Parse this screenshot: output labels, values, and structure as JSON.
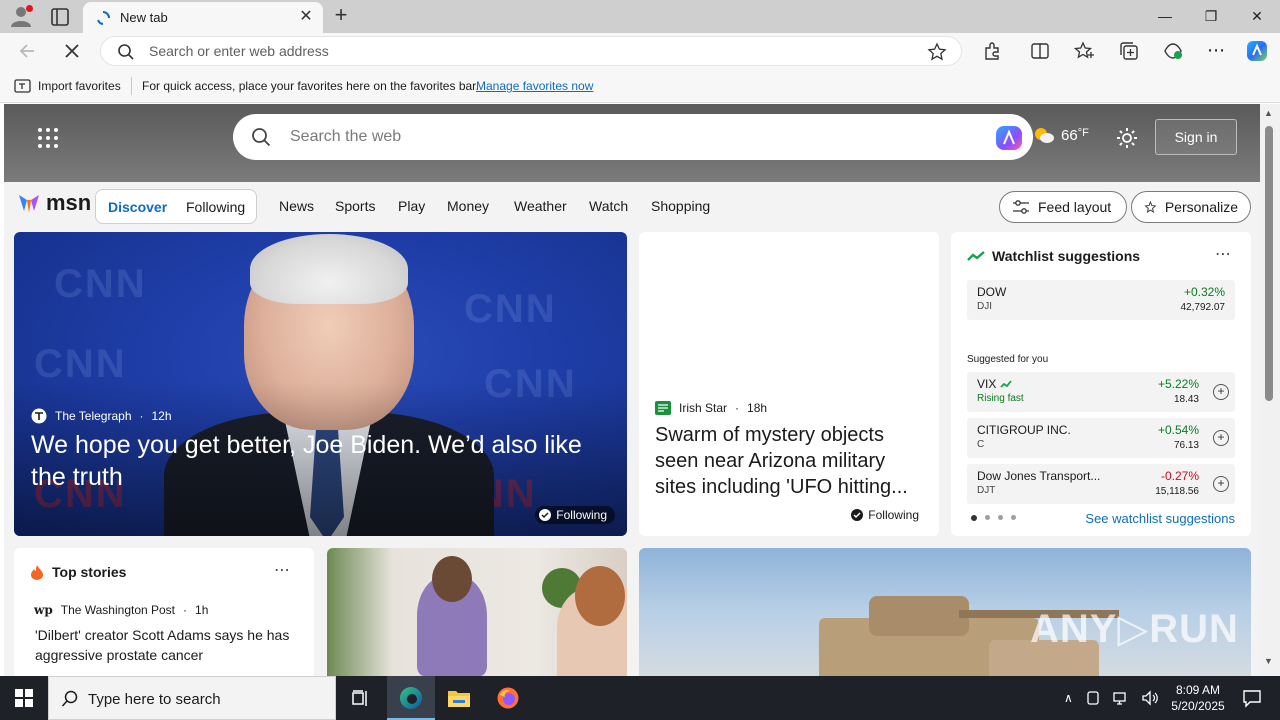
{
  "browser": {
    "tab_title": "New tab",
    "address_placeholder": "Search or enter web address"
  },
  "favorites_bar": {
    "import_label": "Import favorites",
    "hint": "For quick access, place your favorites here on the favorites bar.",
    "manage_link": "Manage favorites now"
  },
  "msn_header": {
    "search_placeholder": "Search the web",
    "temperature": "66",
    "temp_unit": "°F",
    "sign_in": "Sign in",
    "logo": "msn"
  },
  "feed_nav": {
    "segments": [
      "Discover",
      "Following"
    ],
    "links": [
      "News",
      "Sports",
      "Play",
      "Money",
      "Weather",
      "Watch",
      "Shopping"
    ],
    "feed_layout": "Feed layout",
    "personalize": "Personalize"
  },
  "hero": {
    "source": "The Telegraph",
    "age": "12h",
    "title": "We hope you get better, Joe Biden. We’d also like the truth",
    "following": "Following"
  },
  "card2": {
    "source": "Irish Star",
    "age": "18h",
    "title": "Swarm of mystery objects seen near Arizona military sites including 'UFO hitting...",
    "following": "Following"
  },
  "watchlist": {
    "title": "Watchlist suggestions",
    "suggested_label": "Suggested for you",
    "see_all": "See watchlist suggestions",
    "stocks": [
      {
        "symbol": "DOW",
        "sub": "DJI",
        "change": "+0.32%",
        "price": "42,792.07"
      },
      {
        "symbol": "VIX",
        "sub": "Rising fast",
        "change": "+5.22%",
        "price": "18.43"
      },
      {
        "symbol": "CITIGROUP INC.",
        "sub": "C",
        "change": "+0.54%",
        "price": "76.13"
      },
      {
        "symbol": "Dow Jones Transport...",
        "sub": "DJT",
        "change": "-0.27%",
        "price": "15,118.56"
      }
    ]
  },
  "top_stories": {
    "title": "Top stories",
    "source": "The Washington Post",
    "age": "1h",
    "headline": "'Dilbert' creator Scott Adams says he has aggressive prostate cancer"
  },
  "taskbar": {
    "search_placeholder": "Type here to search",
    "time": "8:09 AM",
    "date": "5/20/2025"
  },
  "colors": {
    "accent": "#0f6cbd",
    "positive": "#0a7a1f",
    "negative": "#c50f1f"
  }
}
